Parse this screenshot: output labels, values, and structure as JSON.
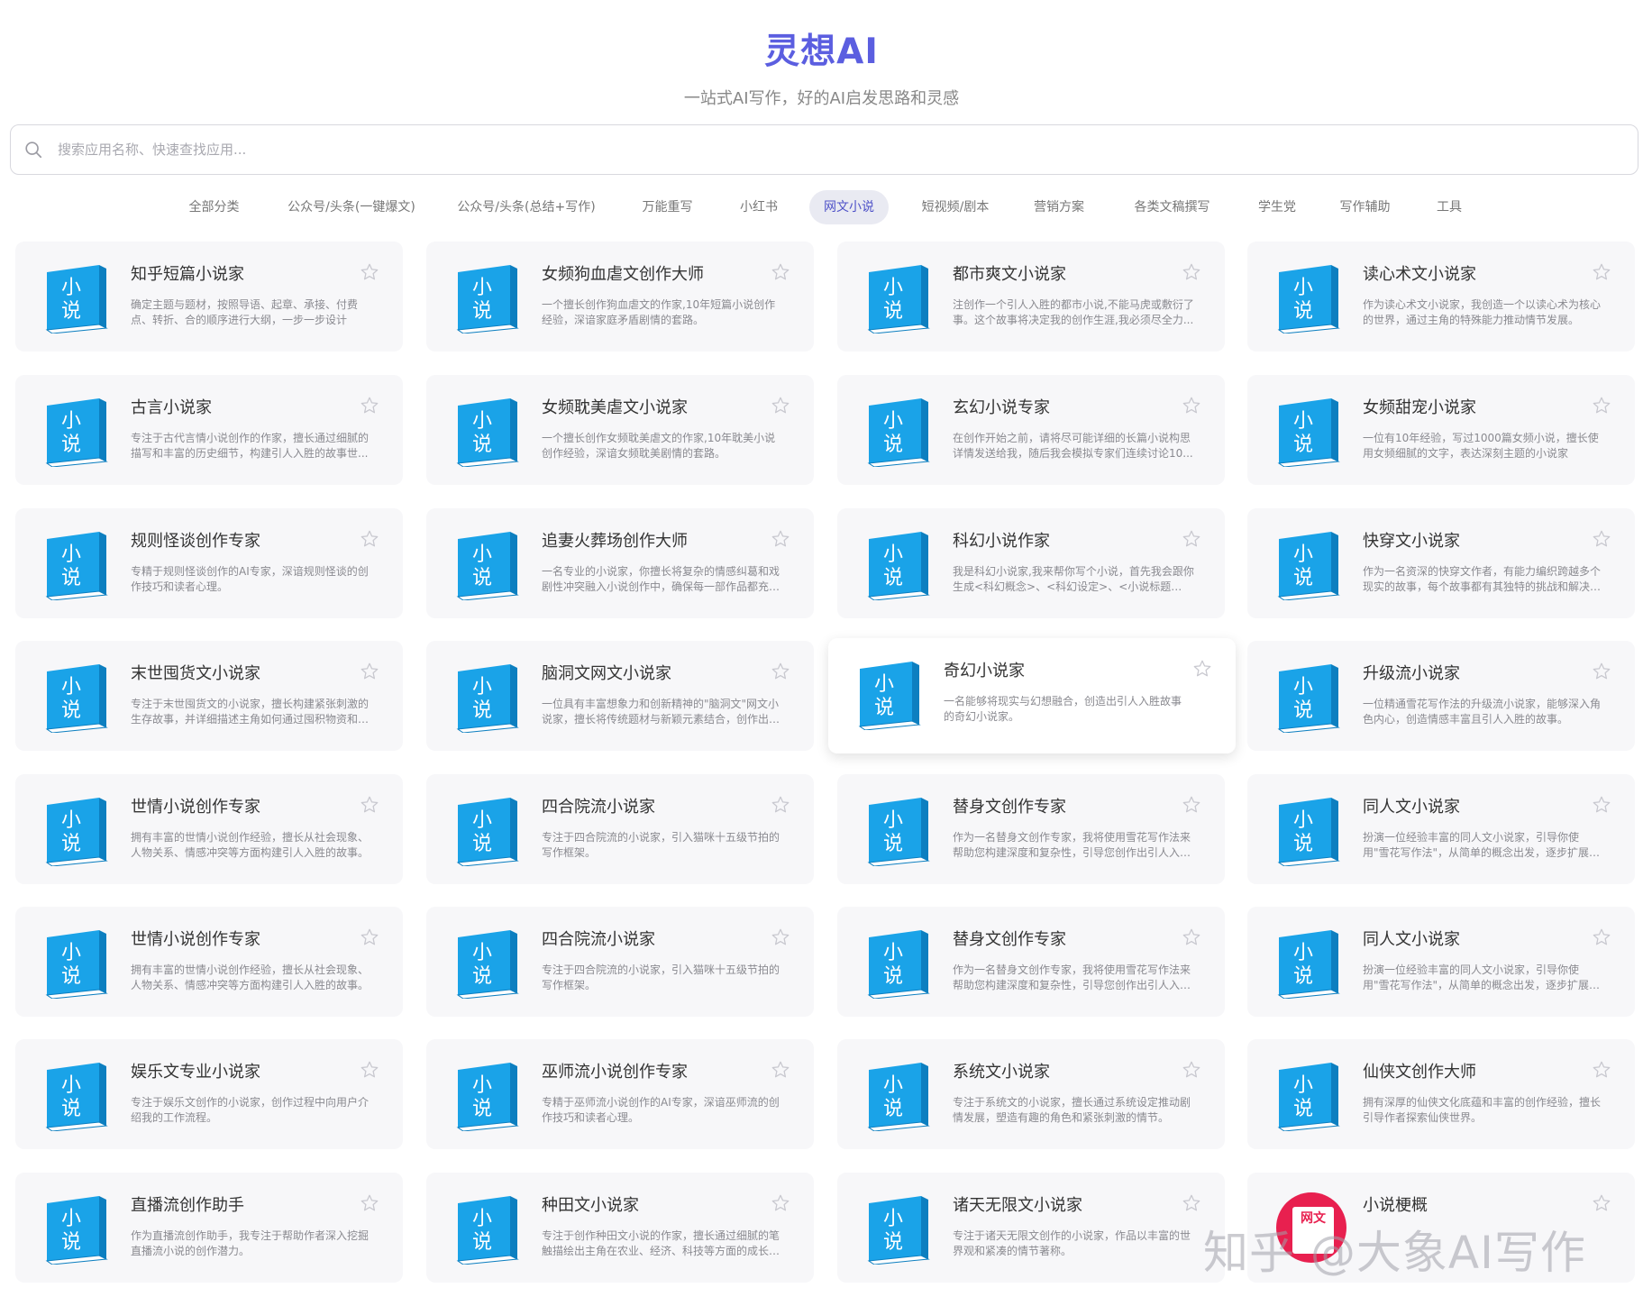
{
  "header": {
    "title": "灵想AI",
    "subtitle": "一站式AI写作，好的AI启发思路和灵感"
  },
  "search": {
    "placeholder": "搜索应用名称、快速查找应用..."
  },
  "tabs": [
    {
      "label": "全部分类",
      "active": false
    },
    {
      "label": "公众号/头条(一键爆文)",
      "active": false
    },
    {
      "label": "公众号/头条(总结+写作)",
      "active": false
    },
    {
      "label": "万能重写",
      "active": false
    },
    {
      "label": "小红书",
      "active": false
    },
    {
      "label": "网文小说",
      "active": true
    },
    {
      "label": "短视频/剧本",
      "active": false
    },
    {
      "label": "营销方案",
      "active": false
    },
    {
      "label": "各类文稿撰写",
      "active": false
    },
    {
      "label": "学生党",
      "active": false
    },
    {
      "label": "写作辅助",
      "active": false
    },
    {
      "label": "工具",
      "active": false
    }
  ],
  "book_icon_text": [
    "小",
    "说"
  ],
  "cards": [
    {
      "title": "知乎短篇小说家",
      "desc": "确定主题与题材，按照导语、起章、承接、付费点、转折、合的顺序进行大纲，一步一步设计"
    },
    {
      "title": "女频狗血虐文创作大师",
      "desc": "一个擅长创作狗血虐文的作家,10年短篇小说创作经验，深谙家庭矛盾剧情的套路。"
    },
    {
      "title": "都市爽文小说家",
      "desc": "注创作一个引人入胜的都市小说,不能马虎或敷衍了事。这个故事将决定我的创作生涯,我必须尽全力..."
    },
    {
      "title": "读心术文小说家",
      "desc": "作为读心术文小说家，我创造一个以读心术为核心的世界，通过主角的特殊能力推动情节发展。"
    },
    {
      "title": "古言小说家",
      "desc": "专注于古代言情小说创作的作家，擅长通过细腻的描写和丰富的历史细节，构建引人入胜的故事世..."
    },
    {
      "title": "女频耽美虐文小说家",
      "desc": "一个擅长创作女频耽美虐文的作家,10年耽美小说创作经验，深谙女频耽美剧情的套路。"
    },
    {
      "title": "玄幻小说专家",
      "desc": "在创作开始之前，请将尽可能详细的长篇小说构思详情发送给我，随后我会模拟专家们连续讨论10..."
    },
    {
      "title": "女频甜宠小说家",
      "desc": "一位有10年经验，写过1000篇女频小说，擅长使用女频细腻的文字，表达深刻主题的小说家"
    },
    {
      "title": "规则怪谈创作专家",
      "desc": "专精于规则怪谈创作的AI专家，深谙规则怪谈的创作技巧和读者心理。"
    },
    {
      "title": "追妻火葬场创作大师",
      "desc": "一名专业的小说家，你擅长将复杂的情感纠葛和戏剧性冲突融入小说创作中，确保每一部作品都充满..."
    },
    {
      "title": "科幻小说作家",
      "desc": "我是科幻小说家,我来帮你写个小说，首先我会跟你生成<科幻概念>、<科幻设定>、<小说标题>、..."
    },
    {
      "title": "快穿文小说家",
      "desc": "作为一名资深的快穿文作者，有能力编织跨越多个现实的故事，每个故事都有其独特的挑战和解决方..."
    },
    {
      "title": "末世囤货文小说家",
      "desc": "专注于末世囤货文的小说家，擅长构建紧张刺激的生存故事，并详细描述主角如何通过囤积物资和资..."
    },
    {
      "title": "脑洞文网文小说家",
      "desc": "一位具有丰富想象力和创新精神的\"脑洞文\"网文小说家，擅长将传统题材与新颖元素结合，创作出既独..."
    },
    {
      "title": "奇幻小说家",
      "desc": "一名能够将现实与幻想融合，创造出引人入胜故事的奇幻小说家。"
    },
    {
      "title": "升级流小说家",
      "desc": "一位精通雪花写作法的升级流小说家，能够深入角色内心，创造情感丰富且引人入胜的故事。"
    },
    {
      "title": "世情小说创作专家",
      "desc": "拥有丰富的世情小说创作经验，擅长从社会现象、人物关系、情感冲突等方面构建引人入胜的故事。"
    },
    {
      "title": "四合院流小说家",
      "desc": "专注于四合院流的小说家，引入猫咪十五级节拍的写作框架。"
    },
    {
      "title": "替身文创作专家",
      "desc": "作为一名替身文创作专家，我将使用雪花写作法来帮助您构建深度和复杂性，引导您创作出引人入胜..."
    },
    {
      "title": "同人文小说家",
      "desc": "扮演一位经验丰富的同人文小说家，引导你使用\"雪花写作法\"，从简单的概念出发，逐步扩展，最终..."
    },
    {
      "title": "世情小说创作专家",
      "desc": "拥有丰富的世情小说创作经验，擅长从社会现象、人物关系、情感冲突等方面构建引人入胜的故事。"
    },
    {
      "title": "四合院流小说家",
      "desc": "专注于四合院流的小说家，引入猫咪十五级节拍的写作框架。"
    },
    {
      "title": "替身文创作专家",
      "desc": "作为一名替身文创作专家，我将使用雪花写作法来帮助您构建深度和复杂性，引导您创作出引人入胜..."
    },
    {
      "title": "同人文小说家",
      "desc": "扮演一位经验丰富的同人文小说家，引导你使用\"雪花写作法\"，从简单的概念出发，逐步扩展，最终..."
    },
    {
      "title": "娱乐文专业小说家",
      "desc": "专注于娱乐文创作的小说家，创作过程中向用户介绍我的工作流程。"
    },
    {
      "title": "巫师流小说创作专家",
      "desc": "专精于巫师流小说创作的AI专家，深谙巫师流的创作技巧和读者心理。"
    },
    {
      "title": "系统文小说家",
      "desc": "专注于系统文的小说家，擅长通过系统设定推动剧情发展，塑造有趣的角色和紧张刺激的情节。"
    },
    {
      "title": "仙侠文创作大师",
      "desc": "拥有深厚的仙侠文化底蕴和丰富的创作经验，擅长引导作者探索仙侠世界。"
    },
    {
      "title": "直播流创作助手",
      "desc": "作为直播流创作助手，我专注于帮助作者深入挖掘直播流小说的创作潜力。"
    },
    {
      "title": "种田文小说家",
      "desc": "专注于创作种田文小说的作家，擅长通过细腻的笔触描绘出主角在农业、经济、科技等方面的成长和..."
    },
    {
      "title": "诸天无限文小说家",
      "desc": "专注于诸天无限文创作的小说家，作品以丰富的世界观和紧凑的情节著称。"
    },
    {
      "title": "小说梗概",
      "desc": "",
      "avatar_text": "网文"
    }
  ],
  "watermark": "知乎 @大象AI写作",
  "colors": {
    "accent": "#5b5ee0",
    "book_blue": "#1aa3e8",
    "avatar_red": "#e8204f"
  }
}
